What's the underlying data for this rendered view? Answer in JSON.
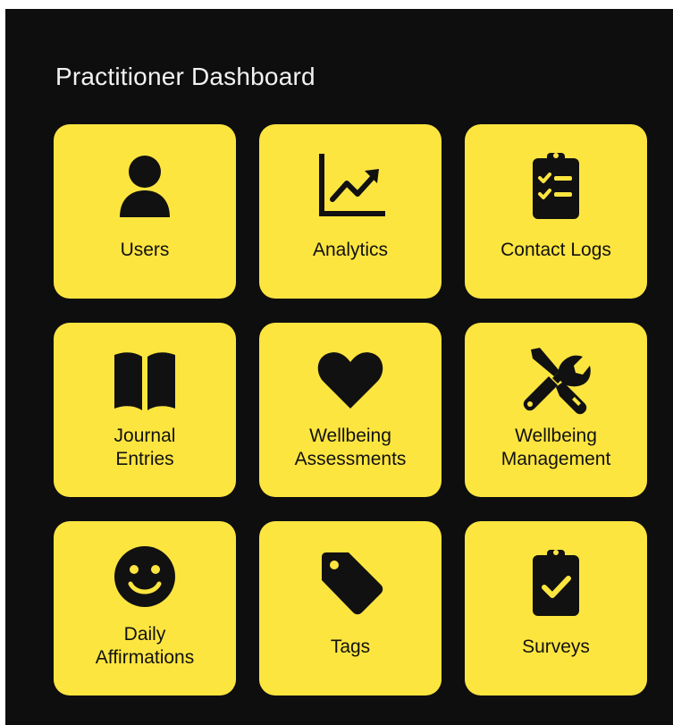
{
  "page": {
    "title": "Practitioner Dashboard"
  },
  "colors": {
    "panel_background": "#0e0e0f",
    "tile_background": "#fde540",
    "tile_foreground": "#111111",
    "title_text": "#f2f2f2"
  },
  "tiles": [
    {
      "label": "Users",
      "icon": "user-icon"
    },
    {
      "label": "Analytics",
      "icon": "chart-icon"
    },
    {
      "label": "Contact Logs",
      "icon": "checklist-clipboard-icon"
    },
    {
      "label": "Journal\nEntries",
      "icon": "book-icon"
    },
    {
      "label": "Wellbeing\nAssessments",
      "icon": "heart-icon"
    },
    {
      "label": "Wellbeing\nManagement",
      "icon": "tools-icon"
    },
    {
      "label": "Daily\nAffirmations",
      "icon": "smiley-icon"
    },
    {
      "label": "Tags",
      "icon": "tag-icon"
    },
    {
      "label": "Surveys",
      "icon": "check-clipboard-icon"
    }
  ]
}
